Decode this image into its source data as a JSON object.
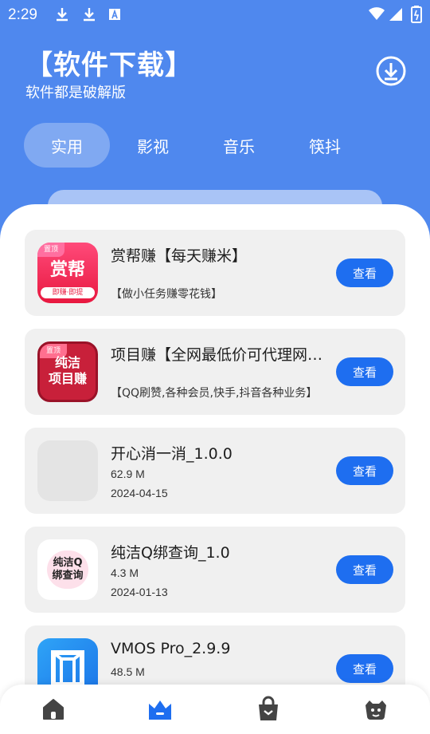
{
  "status": {
    "time": "2:29",
    "icons": [
      "download-icon",
      "download-icon",
      "text-a-icon",
      "wifi-icon",
      "signal-icon",
      "battery-icon"
    ]
  },
  "header": {
    "title": "【软件下载】",
    "subtitle": "软件都是破解版",
    "download_icon": "download-circle-icon"
  },
  "tabs": [
    {
      "label": "实用",
      "active": true
    },
    {
      "label": "影视",
      "active": false
    },
    {
      "label": "音乐",
      "active": false
    },
    {
      "label": "筷抖",
      "active": false
    }
  ],
  "items": [
    {
      "title": "赏帮赚【每天赚米】",
      "desc": "【做小任务赚零花钱】",
      "button": "查看",
      "icon_text": "赏帮",
      "icon_sub": "即赚·即提",
      "badge": "置顶"
    },
    {
      "title": "项目赚【全网最低价可代理网站】",
      "desc": "【QQ刷赞,各种会员,快手,抖音各种业务】",
      "button": "查看",
      "icon_text": "纯洁\n项目赚",
      "badge": "置顶"
    },
    {
      "title": "开心消一消_1.0.0",
      "size": "62.9 M",
      "date": "2024-04-15",
      "button": "查看"
    },
    {
      "title": "纯洁Q绑查询_1.0",
      "size": "4.3 M",
      "date": "2024-01-13",
      "button": "查看",
      "icon_text": "纯洁Q\n绑查询"
    },
    {
      "title": "VMOS Pro_2.9.9",
      "size": "48.5 M",
      "button": "查看"
    }
  ],
  "nav": [
    {
      "icon": "home-icon"
    },
    {
      "icon": "crown-icon",
      "active": true
    },
    {
      "icon": "shopping-bag-icon"
    },
    {
      "icon": "profile-icon"
    }
  ],
  "colors": {
    "primary": "#4f88ee",
    "button": "#1e6ef0",
    "active_nav": "#1e6ef0",
    "nav_icon": "#444444"
  }
}
